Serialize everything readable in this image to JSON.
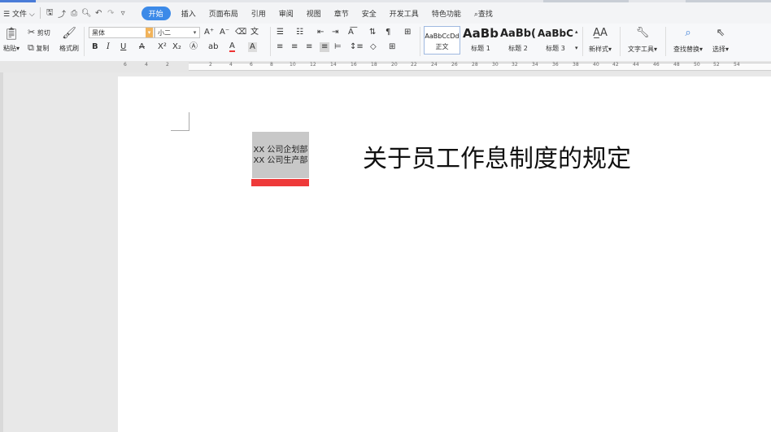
{
  "menubar": {
    "menu_label": "文件",
    "tabs": [
      {
        "label": "开始",
        "active": true
      },
      {
        "label": "插入"
      },
      {
        "label": "页面布局"
      },
      {
        "label": "引用"
      },
      {
        "label": "审阅"
      },
      {
        "label": "视图"
      },
      {
        "label": "章节"
      },
      {
        "label": "安全"
      },
      {
        "label": "开发工具"
      },
      {
        "label": "特色功能"
      }
    ],
    "search_label": "查找"
  },
  "ribbon": {
    "paste": "粘贴",
    "cut": "剪切",
    "copy": "复制",
    "format_painter": "格式刷",
    "font_name": "黑体",
    "font_size": "小二",
    "styles": [
      {
        "sample": "AaBbCcDd",
        "name": "正文"
      },
      {
        "sample": "AaBb",
        "name": "标题 1"
      },
      {
        "sample": "AaBb(",
        "name": "标题 2"
      },
      {
        "sample": "AaBbC(",
        "name": "标题 3"
      }
    ],
    "new_style": "新样式",
    "text_tools": "文字工具",
    "find_replace": "查找替换",
    "select": "选择"
  },
  "ruler": {
    "numbers": [
      "6",
      "4",
      "2",
      "2",
      "4",
      "6",
      "8",
      "10",
      "12",
      "14",
      "16",
      "18",
      "20",
      "22",
      "24",
      "26",
      "28",
      "30",
      "32",
      "34",
      "36",
      "38",
      "40",
      "42",
      "44",
      "46",
      "48",
      "50",
      "52",
      "54"
    ]
  },
  "document": {
    "box_line1": "XX 公司企划部",
    "box_line2": "XX 公司生产部",
    "title": "关于员工作息制度的规定"
  },
  "colors": {
    "accent": "#3c8ae8",
    "red_bar": "#ee3a3a",
    "box_gray": "#c8c8c8"
  }
}
